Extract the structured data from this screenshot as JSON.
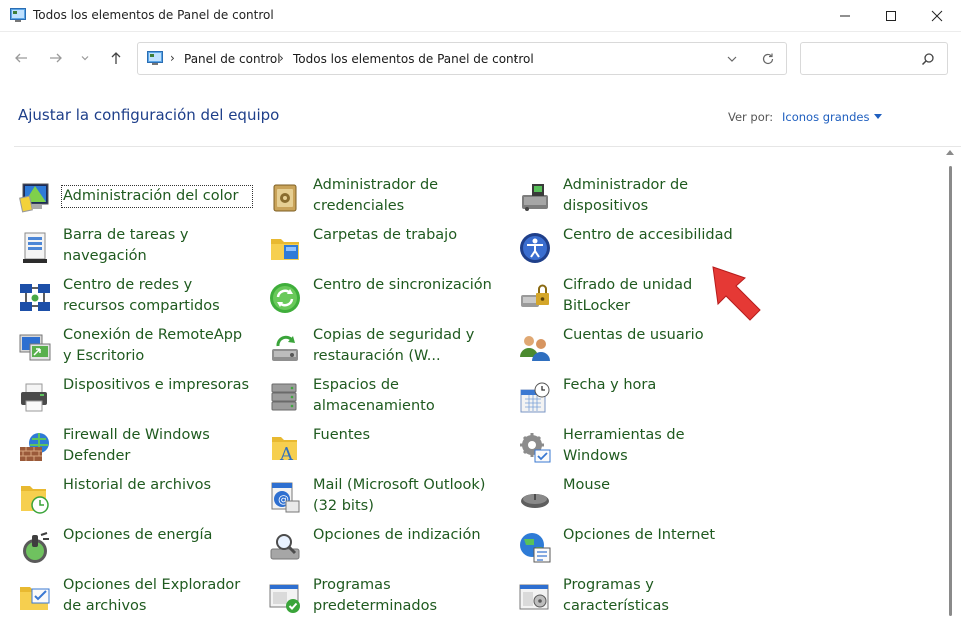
{
  "window": {
    "title": "Todos los elementos de Panel de control",
    "minimize_icon": "minimize-icon",
    "maximize_icon": "maximize-icon",
    "close_icon": "close-icon"
  },
  "nav": {
    "breadcrumb": [
      "Panel de control",
      "Todos los elementos de Panel de control"
    ],
    "search_placeholder": ""
  },
  "header": {
    "title": "Ajustar la configuración del equipo",
    "view_label": "Ver por:",
    "view_value": "Iconos grandes"
  },
  "items": [
    {
      "label": "Administración del color",
      "icon": "color-management-icon"
    },
    {
      "label": "Administrador de credenciales",
      "icon": "credential-manager-icon"
    },
    {
      "label": "Administrador de dispositivos",
      "icon": "device-manager-icon"
    },
    {
      "label": "Barra de tareas y navegación",
      "icon": "taskbar-icon"
    },
    {
      "label": "Carpetas de trabajo",
      "icon": "work-folders-icon"
    },
    {
      "label": "Centro de accesibilidad",
      "icon": "accessibility-icon"
    },
    {
      "label": "Centro de redes y recursos compartidos",
      "icon": "network-icon"
    },
    {
      "label": "Centro de sincronización",
      "icon": "sync-center-icon"
    },
    {
      "label": "Cifrado de unidad BitLocker",
      "icon": "bitlocker-icon"
    },
    {
      "label": "Conexión de RemoteApp y Escritorio",
      "icon": "remoteapp-icon"
    },
    {
      "label": "Copias de seguridad y restauración (W...",
      "icon": "backup-icon"
    },
    {
      "label": "Cuentas de usuario",
      "icon": "user-accounts-icon"
    },
    {
      "label": "Dispositivos e impresoras",
      "icon": "printer-icon"
    },
    {
      "label": "Espacios de almacenamiento",
      "icon": "storage-spaces-icon"
    },
    {
      "label": "Fecha y hora",
      "icon": "date-time-icon"
    },
    {
      "label": "Firewall de Windows Defender",
      "icon": "firewall-icon"
    },
    {
      "label": "Fuentes",
      "icon": "fonts-icon"
    },
    {
      "label": "Herramientas de Windows",
      "icon": "windows-tools-icon"
    },
    {
      "label": "Historial de archivos",
      "icon": "file-history-icon"
    },
    {
      "label": "Mail (Microsoft Outlook) (32 bits)",
      "icon": "mail-icon"
    },
    {
      "label": "Mouse",
      "icon": "mouse-icon"
    },
    {
      "label": "Opciones de energía",
      "icon": "power-options-icon"
    },
    {
      "label": "Opciones de indización",
      "icon": "indexing-icon"
    },
    {
      "label": "Opciones de Internet",
      "icon": "internet-options-icon"
    },
    {
      "label": "Opciones del Explorador de archivos",
      "icon": "explorer-options-icon"
    },
    {
      "label": "Programas predeterminados",
      "icon": "default-programs-icon"
    },
    {
      "label": "Programas y características",
      "icon": "programs-features-icon"
    }
  ],
  "colors": {
    "link_green": "#1f5a1f",
    "title_blue": "#1e3f8a",
    "accent_blue": "#1f5fbf",
    "annotation_arrow": "#e53935"
  }
}
